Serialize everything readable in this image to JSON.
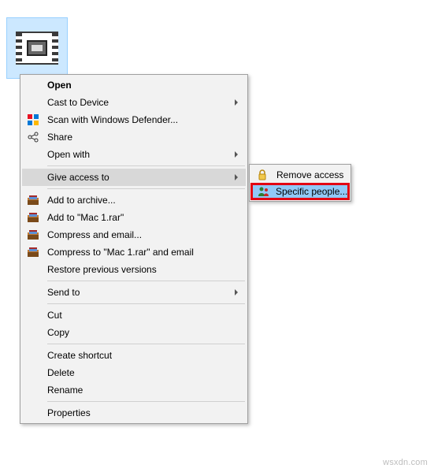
{
  "file": {
    "selected": true
  },
  "menu": {
    "open": "Open",
    "cast": "Cast to Device",
    "scan": "Scan with Windows Defender...",
    "share": "Share",
    "open_with": "Open with",
    "give_access": "Give access to",
    "add_archive": "Add to archive...",
    "add_mac1rar": "Add to \"Mac 1.rar\"",
    "compress_email": "Compress and email...",
    "compress_mac1rar_email": "Compress to \"Mac 1.rar\" and email",
    "restore_previous": "Restore previous versions",
    "send_to": "Send to",
    "cut": "Cut",
    "copy": "Copy",
    "create_shortcut": "Create shortcut",
    "delete": "Delete",
    "rename": "Rename",
    "properties": "Properties"
  },
  "submenu": {
    "remove_access": "Remove access",
    "specific_people": "Specific people..."
  },
  "watermark": "wsxdn.com"
}
